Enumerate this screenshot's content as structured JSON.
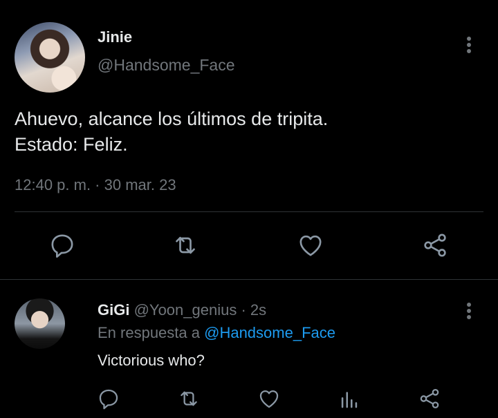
{
  "main_tweet": {
    "author_name": "Jinie",
    "author_handle": "@Handsome_Face",
    "text_line_1": "Ahuevo, alcance los últimos de tripita.",
    "text_line_2": "Estado: Feliz.",
    "timestamp": "12:40 p. m. · 30 mar. 23",
    "actions": [
      "reply-icon",
      "retweet-icon",
      "like-icon",
      "share-icon"
    ]
  },
  "reply_tweet": {
    "author_name": "GiGi",
    "author_handle": "@Yoon_genius",
    "separator": " · ",
    "time": "2s",
    "context_prefix": "En respuesta a ",
    "context_mention": "@Handsome_Face",
    "text": "Victorious who?",
    "actions": [
      "reply-icon",
      "retweet-icon",
      "like-icon",
      "views-icon",
      "share-icon"
    ]
  },
  "colors": {
    "background": "#000000",
    "primary_text": "#e7e9ea",
    "secondary_text": "#71767b",
    "icon": "#8b98a5",
    "accent": "#1d9bf0",
    "divider": "#2f3336"
  }
}
